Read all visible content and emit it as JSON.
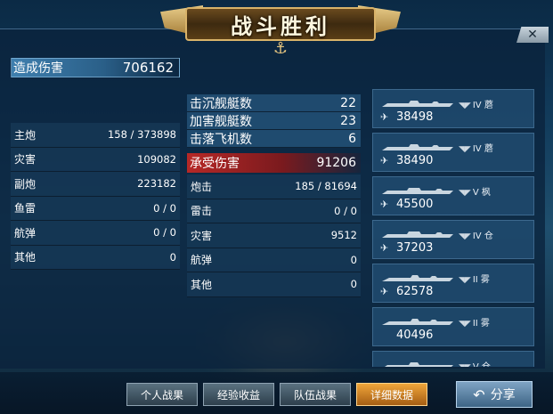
{
  "banner": {
    "title": "战斗胜利"
  },
  "close": {
    "label": "✕"
  },
  "damage": {
    "label": "造成伤害",
    "value": "706162"
  },
  "dealt_rows": [
    {
      "label": "主炮",
      "value": "158 / 373898"
    },
    {
      "label": "灾害",
      "value": "109082"
    },
    {
      "label": "副炮",
      "value": "223182"
    },
    {
      "label": "鱼雷",
      "value": "0 / 0"
    },
    {
      "label": "航弹",
      "value": "0 / 0"
    },
    {
      "label": "其他",
      "value": "0"
    }
  ],
  "summary_rows": [
    {
      "label": "击沉舰艇数",
      "value": "22"
    },
    {
      "label": "加害舰艇数",
      "value": "23"
    },
    {
      "label": "击落飞机数",
      "value": "6"
    }
  ],
  "taken": {
    "label": "承受伤害",
    "value": "91206"
  },
  "taken_rows": [
    {
      "label": "炮击",
      "value": "185 / 81694"
    },
    {
      "label": "雷击",
      "value": "0 / 0"
    },
    {
      "label": "灾害",
      "value": "9512"
    },
    {
      "label": "航弹",
      "value": "0"
    },
    {
      "label": "其他",
      "value": "0"
    }
  ],
  "ships": [
    {
      "tier": "IV 蘑",
      "damage": "38498",
      "plane": true
    },
    {
      "tier": "IV 蘑",
      "damage": "38490",
      "plane": true
    },
    {
      "tier": "V 枫",
      "damage": "45500",
      "plane": true
    },
    {
      "tier": "IV 仓",
      "damage": "37203",
      "plane": true
    },
    {
      "tier": "II 雾",
      "damage": "62578",
      "plane": true
    },
    {
      "tier": "II 雾",
      "damage": "40496",
      "plane": false
    },
    {
      "tier": "V 仓",
      "damage": "",
      "plane": false
    }
  ],
  "tabs": [
    {
      "label": "个人战果",
      "active": false
    },
    {
      "label": "经验收益",
      "active": false
    },
    {
      "label": "队伍战果",
      "active": false
    },
    {
      "label": "详细数据",
      "active": true
    }
  ],
  "share": {
    "label": "分享"
  }
}
